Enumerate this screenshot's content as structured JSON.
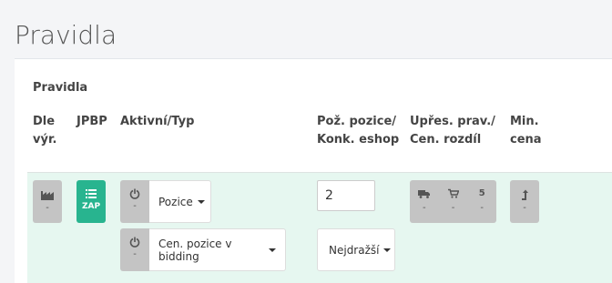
{
  "page": {
    "title": "Pravidla"
  },
  "panel": {
    "title": "Pravidla"
  },
  "columns": {
    "dle_vyr": "Dle\nvýr.",
    "jpbp": "JPBP",
    "aktivni_typ": "Aktivní/Typ",
    "poz_pozice": "Pož. pozice/\nKonk. eshop",
    "upres": "Upřes. prav./\nCen. rozdíl",
    "min_cena": "Min.\ncena"
  },
  "row": {
    "dle_vyr": {
      "icon": "factory-icon",
      "value": "-"
    },
    "jpbp": {
      "icon": "list-icon",
      "label": "ZAP",
      "color": "#28b48f"
    },
    "rule1": {
      "power_value": "-",
      "type": "Pozice"
    },
    "rule2": {
      "power_value": "-",
      "type": "Cen. pozice v bidding"
    },
    "position_input": "2",
    "competitor_select": "Nejdražší",
    "upres": {
      "cells": [
        {
          "icon": "truck-icon",
          "value": "-"
        },
        {
          "icon": "cart-icon",
          "value": "-"
        },
        {
          "label": "5",
          "value": "-"
        }
      ]
    },
    "min_cena": {
      "icon": "level-up-icon",
      "value": "-"
    }
  },
  "colors": {
    "row_bg": "#e6f7f0",
    "grey_button": "#c4c4c4",
    "accent": "#28b48f"
  }
}
